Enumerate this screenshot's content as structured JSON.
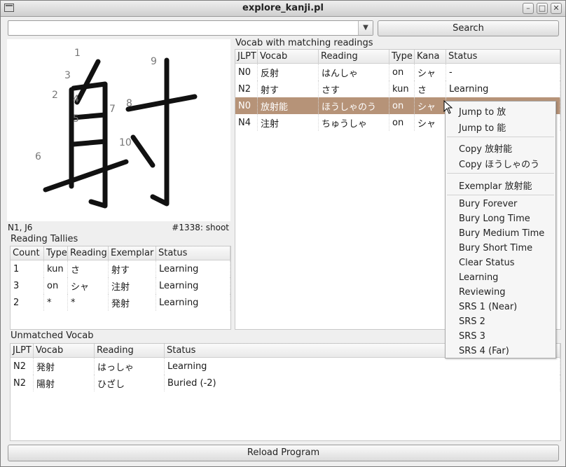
{
  "window": {
    "title": "explore_kanji.pl"
  },
  "search": {
    "value": "",
    "button": "Search"
  },
  "kanji": {
    "character": "射",
    "stroke_numbers": [
      "1",
      "2",
      "3",
      "4",
      "5",
      "6",
      "7",
      "8",
      "9",
      "10"
    ],
    "info_left": "N1, J6",
    "info_right": "#1338: shoot"
  },
  "reading_tallies": {
    "title": "Reading Tallies",
    "columns": [
      "Count",
      "Type",
      "Reading",
      "Exemplar",
      "Status"
    ],
    "rows": [
      [
        "1",
        "kun",
        "さ",
        "射す",
        "Learning"
      ],
      [
        "3",
        "on",
        "シャ",
        "注射",
        "Learning"
      ],
      [
        "2",
        "*",
        "*",
        "発射",
        "Learning"
      ]
    ]
  },
  "vocab": {
    "title": "Vocab with matching readings",
    "columns": [
      "JLPT",
      "Vocab",
      "Reading",
      "Type",
      "Kana",
      "Status"
    ],
    "rows": [
      [
        "N0",
        "反射",
        "はんしゃ",
        "on",
        "シャ",
        "-"
      ],
      [
        "N2",
        "射す",
        "さす",
        "kun",
        "さ",
        "Learning"
      ],
      [
        "N0",
        "放射能",
        "ほうしゃのう",
        "on",
        "シャ",
        ""
      ],
      [
        "N4",
        "注射",
        "ちゅうしゃ",
        "on",
        "シャ",
        ""
      ]
    ]
  },
  "unmatched": {
    "title": "Unmatched Vocab",
    "columns": [
      "JLPT",
      "Vocab",
      "Reading",
      "Status"
    ],
    "rows": [
      [
        "N2",
        "発射",
        "はっしゃ",
        "Learning"
      ],
      [
        "N2",
        "陽射",
        "ひざし",
        "Buried (-2)"
      ]
    ]
  },
  "context_menu": {
    "items": [
      "Jump to 放",
      "Jump to 能",
      "Copy 放射能",
      "Copy ほうしゃのう",
      "Exemplar 放射能",
      "Bury Forever",
      "Bury Long Time",
      "Bury Medium Time",
      "Bury Short Time",
      "Clear Status",
      "Learning",
      "Reviewing",
      "SRS 1 (Near)",
      "SRS 2",
      "SRS 3",
      "SRS 4 (Far)"
    ]
  },
  "reload_button": "Reload Program",
  "colors": {
    "selection": "#b69378",
    "menu_bg": "#f6f6f6"
  }
}
